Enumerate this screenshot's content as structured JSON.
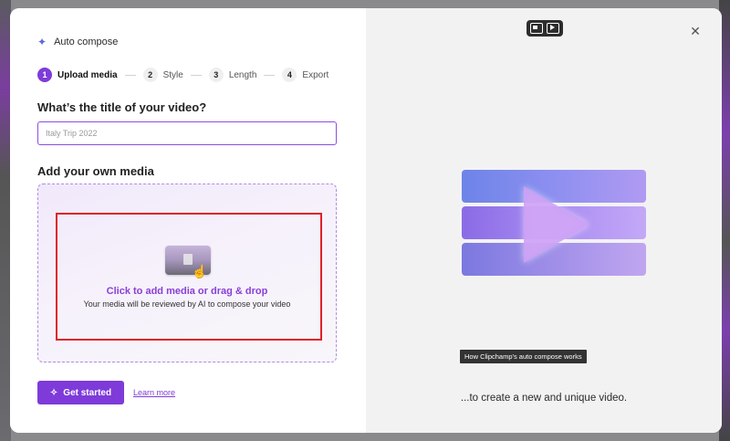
{
  "header": {
    "icon": "sparkle-icon",
    "title": "Auto compose"
  },
  "steps": [
    {
      "num": "1",
      "label": "Upload media",
      "active": true
    },
    {
      "num": "2",
      "label": "Style",
      "active": false
    },
    {
      "num": "3",
      "label": "Length",
      "active": false
    },
    {
      "num": "4",
      "label": "Export",
      "active": false
    }
  ],
  "title_section": {
    "label": "What’s the title of your video?",
    "placeholder": "Italy Trip 2022"
  },
  "media_section": {
    "label": "Add your own media",
    "cta_main": "Click to add media or drag & drop",
    "cta_sub": "Your media will be reviewed by AI to compose your video"
  },
  "actions": {
    "get_started": "Get started",
    "learn_more": "Learn more"
  },
  "preview": {
    "tooltip": "How Clipchamp's auto compose works",
    "caption": "...to create a new and unique video."
  },
  "colors": {
    "accent": "#7e3bd9",
    "highlight": "#e0202a"
  }
}
